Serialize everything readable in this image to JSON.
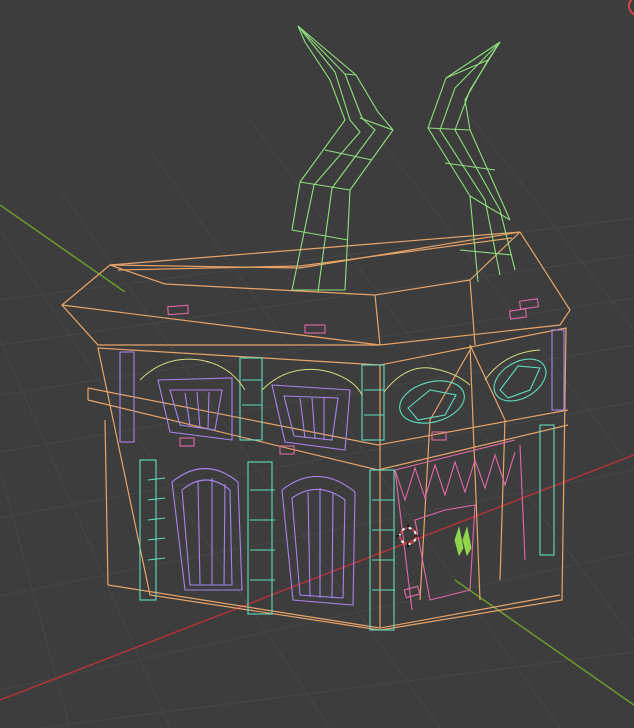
{
  "app": "3D Viewport",
  "viewport": {
    "mode": "wireframe",
    "background": "#3d3d3d",
    "grid_color": "#474747",
    "axis_x_color": "#b0343c",
    "axis_y_color": "#6e9b2e",
    "object_colors": {
      "house_body": "#e7a46a",
      "horns": "#8fe07e",
      "windows": "#a784ea",
      "pillars": "#5fdcbf",
      "teeth": "#e06aa5",
      "trim": "#d8d980"
    },
    "cursor_icon": "3d-cursor-icon",
    "corner_gizmo_icon": "view-gizmo-edge-icon"
  }
}
